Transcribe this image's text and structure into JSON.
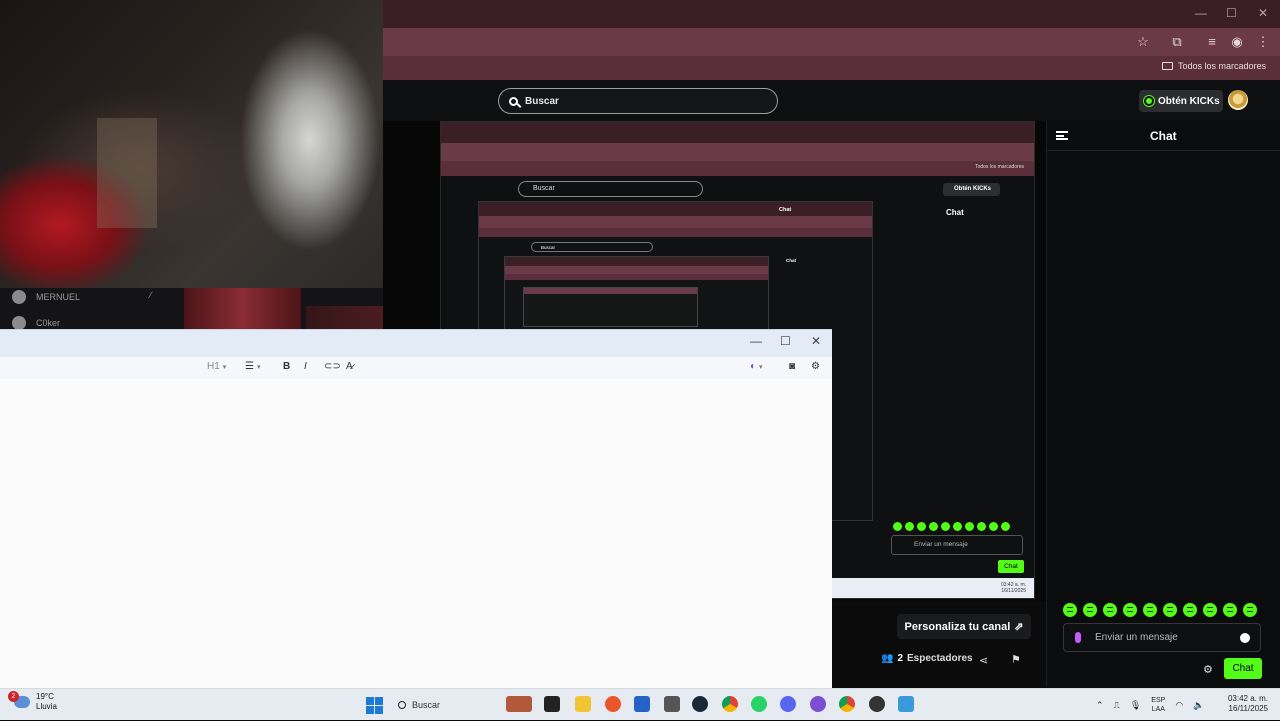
{
  "browser": {
    "bookmarks_label": "Todos los marcadores"
  },
  "kick": {
    "search_placeholder": "Buscar",
    "kicks_button": "Obtén KICKs",
    "chat_title": "Chat",
    "personaliza_label": "Personaliza tu canal",
    "viewers_count": "2",
    "viewers_label": "Espectadores",
    "message_placeholder": "Enviar un mensaje",
    "send_label": "Chat"
  },
  "viewer_list": [
    {
      "name": "MERNUEL"
    },
    {
      "name": "C0ker"
    }
  ],
  "recursive": {
    "search": "Buscar",
    "kicks": "Obtén KICKs",
    "chat": "Chat",
    "bookmarks": "Todos los marcadores",
    "message": "Enviar un mensaje",
    "send": "Chat",
    "partial_label": "canal",
    "taskbar_lang": "ESP\nLAA",
    "taskbar_time": "03:42 a. m.",
    "taskbar_date": "16/11/2025"
  },
  "editor": {
    "heading_select": "H1"
  },
  "taskbar": {
    "weather_temp": "19°C",
    "weather_desc": "Lluvia",
    "weather_badge": "2",
    "search_label": "Buscar",
    "lang_top": "ESP",
    "lang_bottom": "LAA",
    "time": "03:42 a. m.",
    "date": "16/11/2025"
  },
  "colors": {
    "kick_green": "#53fc18",
    "browser_frame": "#3a1f27",
    "browser_toolbar": "#6b3a48"
  }
}
